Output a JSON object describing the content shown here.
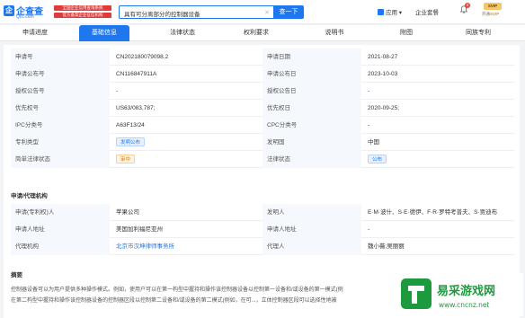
{
  "header": {
    "logo_text": "企查查",
    "logo_sub": "Qcc.com",
    "slogan_1": "全国企业信用查询系统",
    "slogan_2": "官方备案企业征信机构",
    "search_value": "具有可分离部分的控制器设备",
    "search_button": "查一下",
    "app_label": "应用",
    "biz_label": "企业套餐",
    "bell_count": "6",
    "svip_label": "SVIP",
    "svip_sub": "开通SVIP"
  },
  "tabs": [
    "申请进度",
    "基础信息",
    "法律状态",
    "权利要求",
    "说明书",
    "附图",
    "同族专利"
  ],
  "basic": [
    {
      "l1": "申请号",
      "v1": "CN202180079098.2",
      "l2": "申请日期",
      "v2": "2021-08-27"
    },
    {
      "l1": "申请公布号",
      "v1": "CN116847911A",
      "l2": "申请公布日",
      "v2": "2023-10-03"
    },
    {
      "l1": "授权公告号",
      "v1": "-",
      "l2": "授权公告日",
      "v2": "-"
    },
    {
      "l1": "优先权号",
      "v1": "US63/083,787;",
      "l2": "优先权日",
      "v2": "2020-09-25;"
    },
    {
      "l1": "IPC分类号",
      "v1": "A63F13/24",
      "l2": "CPC分类号",
      "v2": "-"
    },
    {
      "l1": "专利类型",
      "v1": "发明公布",
      "l2": "发明国",
      "v2": "中国"
    },
    {
      "l1": "简单法律状态",
      "v1": "审中",
      "l2": "法律状态",
      "v2": "公布"
    }
  ],
  "applicant_section": "申请/代理机构",
  "applicant": [
    {
      "l1": "申请(专利权)人",
      "v1": "苹果公司",
      "l2": "发明人",
      "v2": "E·M·波什、S·E·德伊、F·R·罗特考普夫、S·贾迪布"
    },
    {
      "l1": "申请人地址",
      "v1": "美国加利福尼亚州",
      "l2": "申请人地址",
      "v2": "-"
    },
    {
      "l1": "代理机构",
      "v1": "北京市汉坤律师事务所",
      "l2": "代理人",
      "v2": "魏小薇;吴丽丽"
    }
  ],
  "abstract_section": "摘要",
  "abstract_line1": "控制器设备可以为用户提供多种操作模式。例如，使用户可以在第一构型中握持和操作该控制器设备以控制第一设备和/或设备的第一模式(例",
  "abstract_line2": "在第二构型中握持和操作该控制器设备的控制器区段以控制第二设备和/或设备的第二模式(例如，在可...，立体控制器区段可以选择性地被",
  "watermark_text": "易采游戏网",
  "watermark_url": "www.cncnz.net",
  "colors": {
    "accent": "#1f77f0",
    "badge_red": "#f04134"
  }
}
